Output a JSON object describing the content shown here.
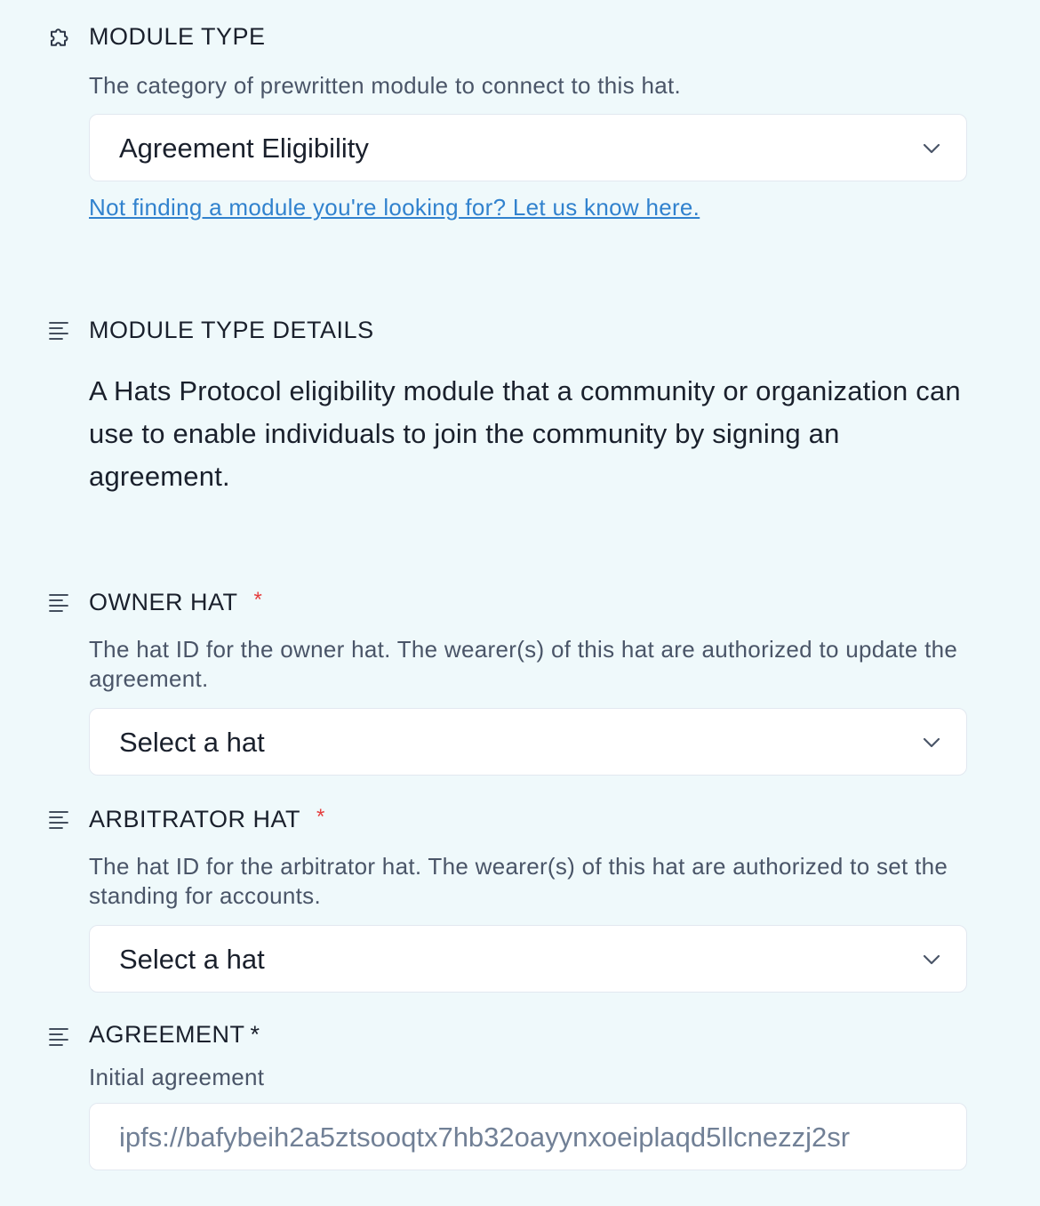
{
  "module_type": {
    "label": "MODULE TYPE",
    "description": "The category of prewritten module to connect to this hat.",
    "selected_value": "Agreement Eligibility",
    "help_link": "Not finding a module you're looking for? Let us know here."
  },
  "module_type_details": {
    "label": "MODULE TYPE DETAILS",
    "body": "A Hats Protocol eligibility module that a community or organization can use to enable individuals to join the community by signing an agreement."
  },
  "owner_hat": {
    "label": "OWNER HAT",
    "required_mark": "*",
    "description": "The hat ID for the owner hat. The wearer(s) of this hat are authorized to update the agreement.",
    "selected_value": "Select a hat"
  },
  "arbitrator_hat": {
    "label": "ARBITRATOR HAT",
    "required_mark": "*",
    "description": "The hat ID for the arbitrator hat. The wearer(s) of this hat are authorized to set the standing for accounts.",
    "selected_value": "Select a hat"
  },
  "agreement": {
    "label": "AGREEMENT",
    "required_mark": "*",
    "description": "Initial agreement",
    "placeholder": "ipfs://bafybeih2a5ztsooqtx7hb32oayynxoeiplaqd5llcnezzj2sr"
  },
  "icons": {
    "module_type": "puzzle-icon",
    "details": "text-align-left-icon",
    "chevron": "chevron-down-icon"
  },
  "colors": {
    "background": "#eff9fb",
    "link": "#3182ce",
    "required": "#e53e3e"
  }
}
